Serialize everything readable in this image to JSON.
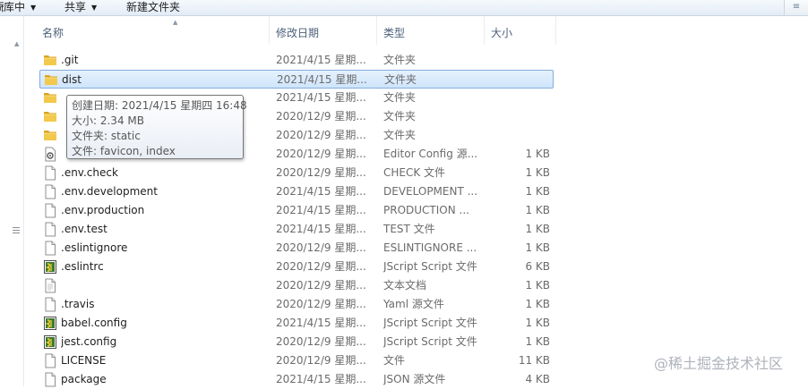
{
  "toolbar": {
    "library_label": "库中",
    "library_prefix": "刷",
    "share_label": "共享",
    "new_folder_label": "新建文件夹"
  },
  "columns": {
    "name": "名称",
    "date": "修改日期",
    "type": "类型",
    "size": "大小"
  },
  "rows": [
    {
      "name": ".git",
      "date": "2021/4/15 星期...",
      "type": "文件夹",
      "size": "",
      "icon": "folder-icon"
    },
    {
      "name": "dist",
      "date": "2021/4/15 星期...",
      "type": "文件夹",
      "size": "",
      "icon": "folder-icon",
      "selected": true
    },
    {
      "name": "",
      "date": "2021/4/15 星期...",
      "type": "文件夹",
      "size": "",
      "icon": "folder-icon"
    },
    {
      "name": "",
      "date": "2020/12/9 星期...",
      "type": "文件夹",
      "size": "",
      "icon": "folder-icon"
    },
    {
      "name": "",
      "date": "2020/12/9 星期...",
      "type": "文件夹",
      "size": "",
      "icon": "folder-icon"
    },
    {
      "name": "",
      "date": "2020/12/9 星期...",
      "type": "Editor Config 源...",
      "size": "1 KB",
      "icon": "config-file-icon"
    },
    {
      "name": ".env.check",
      "date": "2020/12/9 星期...",
      "type": "CHECK 文件",
      "size": "1 KB",
      "icon": "blank-file-icon"
    },
    {
      "name": ".env.development",
      "date": "2021/4/15 星期...",
      "type": "DEVELOPMENT ...",
      "size": "1 KB",
      "icon": "blank-file-icon"
    },
    {
      "name": ".env.production",
      "date": "2021/4/15 星期...",
      "type": "PRODUCTION ...",
      "size": "1 KB",
      "icon": "blank-file-icon"
    },
    {
      "name": ".env.test",
      "date": "2021/4/15 星期...",
      "type": "TEST 文件",
      "size": "1 KB",
      "icon": "blank-file-icon"
    },
    {
      "name": ".eslintignore",
      "date": "2020/12/9 星期...",
      "type": "ESLINTIGNORE ...",
      "size": "1 KB",
      "icon": "blank-file-icon"
    },
    {
      "name": ".eslintrc",
      "date": "2020/12/9 星期...",
      "type": "JScript Script 文件",
      "size": "6 KB",
      "icon": "jscript-file-icon"
    },
    {
      "name": "",
      "date": "2020/12/9 星期...",
      "type": "文本文档",
      "size": "1 KB",
      "icon": "text-file-icon"
    },
    {
      "name": ".travis",
      "date": "2020/12/9 星期...",
      "type": "Yaml 源文件",
      "size": "1 KB",
      "icon": "blank-file-icon"
    },
    {
      "name": "babel.config",
      "date": "2021/4/15 星期...",
      "type": "JScript Script 文件",
      "size": "1 KB",
      "icon": "jscript-file-icon"
    },
    {
      "name": "jest.config",
      "date": "2020/12/9 星期...",
      "type": "JScript Script 文件",
      "size": "1 KB",
      "icon": "jscript-file-icon"
    },
    {
      "name": "LICENSE",
      "date": "2020/12/9 星期...",
      "type": "文件",
      "size": "11 KB",
      "icon": "blank-file-icon"
    },
    {
      "name": "package",
      "date": "2021/4/15 星期...",
      "type": "JSON 源文件",
      "size": "4 KB",
      "icon": "blank-file-icon"
    }
  ],
  "tooltip": {
    "created": "创建日期: 2021/4/15 星期四 16:48",
    "size": "大小: 2.34 MB",
    "folders": "文件夹: static",
    "files": "文件: favicon, index"
  },
  "watermark": "@稀土掘金技术社区",
  "colors": {
    "selection_fill": "#cfe5fb",
    "selection_border": "#84acdd",
    "folder_yellow": "#e8b83a",
    "header_text": "#4c607a"
  }
}
